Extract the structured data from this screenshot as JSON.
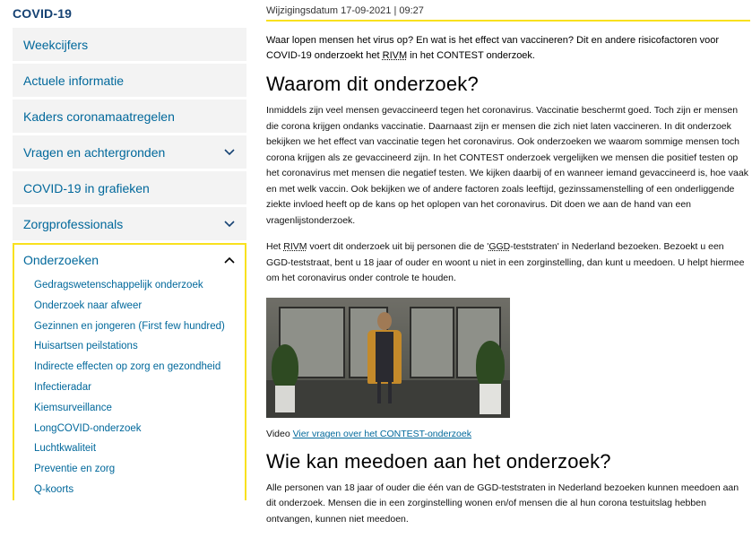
{
  "sidebar": {
    "title": "COVID-19",
    "items": [
      {
        "label": "Weekcijfers",
        "expandable": false
      },
      {
        "label": "Actuele informatie",
        "expandable": false
      },
      {
        "label": "Kaders coronamaatregelen",
        "expandable": false
      },
      {
        "label": "Vragen en achtergronden",
        "expandable": true
      },
      {
        "label": "COVID-19 in grafieken",
        "expandable": false
      },
      {
        "label": "Zorgprofessionals",
        "expandable": true
      }
    ],
    "open_section": {
      "label": "Onderzoeken",
      "subitems": [
        "Gedragswetenschappelijk onderzoek",
        "Onderzoek naar afweer",
        "Gezinnen en jongeren (First few hundred)",
        "Huisartsen peilstations",
        "Indirecte effecten op zorg en gezondheid",
        "Infectieradar",
        "Kiemsurveillance",
        "LongCOVID-onderzoek",
        "Luchtkwaliteit",
        "Preventie en zorg",
        "Q-koorts"
      ]
    }
  },
  "main": {
    "modified": "Wijzigingsdatum 17-09-2021 | 09:27",
    "intro_a": "Waar lopen mensen het virus op? En wat is het effect van vaccineren?  Dit en andere risicofactoren voor COVID-19 onderzoekt het ",
    "intro_abbr": "RIVM",
    "intro_b": " in het CONTEST onderzoek.",
    "heading1": "Waarom dit onderzoek?",
    "para1": "Inmiddels zijn veel mensen gevaccineerd tegen het coronavirus. Vaccinatie beschermt goed. Toch zijn er mensen die corona krijgen ondanks vaccinatie. Daarnaast zijn er mensen die zich niet laten vaccineren. In dit onderzoek bekijken we het effect van vaccinatie tegen het coronavirus. Ook onderzoeken we waarom sommige mensen toch corona krijgen als ze gevaccineerd zijn. In het CONTEST onderzoek vergelijken we mensen die positief testen op het coronavirus met mensen die negatief testen. We kijken daarbij of en wanneer iemand gevaccineerd is, hoe vaak en met welk vaccin. Ook bekijken we of andere factoren zoals leeftijd, gezinssamenstelling of een onderliggende ziekte invloed heeft op de kans op het oplopen van het coronavirus. Dit doen we aan de hand van een vragenlijstonderzoek.",
    "para2_a": "Het ",
    "para2_abbr1": "RIVM",
    "para2_b": " voert dit onderzoek uit bij personen die de '",
    "para2_abbr2": "GGD",
    "para2_c": "-teststraten' in Nederland bezoeken. Bezoekt u een GGD-teststraat, bent u 18 jaar of ouder en woont u niet in een zorginstelling, dan kunt u meedoen. U helpt hiermee om het coronavirus onder controle te houden.",
    "video_prefix": "Video ",
    "video_link": "Vier vragen over het CONTEST-onderzoek",
    "heading2": "Wie kan meedoen aan het onderzoek?",
    "para3": "Alle personen van 18 jaar of ouder die één van de GGD-teststraten in Nederland bezoeken kunnen meedoen aan dit onderzoek. Mensen die in een zorginstelling wonen en/of mensen die al hun corona testuitslag hebben ontvangen, kunnen niet meedoen."
  },
  "colors": {
    "brand_blue": "#154273",
    "link_blue": "#01689b",
    "accent_yellow": "#f9e11e",
    "nav_bg": "#f3f3f3"
  },
  "icons": {
    "expand": "chevron-down-icon",
    "collapse": "chevron-up-icon"
  }
}
